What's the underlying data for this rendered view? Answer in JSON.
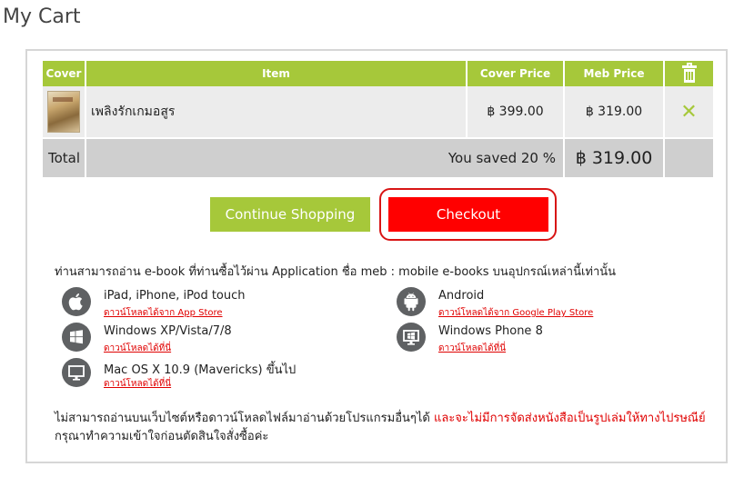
{
  "page": {
    "title": "My Cart"
  },
  "cart": {
    "headers": {
      "cover": "Cover",
      "item": "Item",
      "cover_price": "Cover Price",
      "meb_price": "Meb Price"
    },
    "items": [
      {
        "title": "เพลิงรักเกมอสูร",
        "cover_price": "฿ 399.00",
        "meb_price": "฿ 319.00",
        "remove_symbol": "✕"
      }
    ],
    "total": {
      "label": "Total",
      "saved_text": "You saved 20 %",
      "amount": "฿ 319.00"
    }
  },
  "buttons": {
    "continue_label": "Continue Shopping",
    "checkout_label": "Checkout"
  },
  "info": {
    "intro": "ท่านสามารถอ่าน e-book ที่ท่านซื้อไว้ผ่าน Application ชื่อ meb : mobile e-books บนอุปกรณ์เหล่านี้เท่านั้น",
    "platforms": [
      {
        "name": "iPad, iPhone, iPod touch",
        "link": "ดาวน์โหลดได้จาก App Store",
        "icon": "apple-icon"
      },
      {
        "name": "Android",
        "link": "ดาวน์โหลดได้จาก Google Play Store",
        "icon": "android-icon"
      },
      {
        "name": "Windows XP/Vista/7/8",
        "link": "ดาวน์โหลดได้ที่นี่",
        "icon": "windows-icon"
      },
      {
        "name": "Windows Phone 8",
        "link": "ดาวน์โหลดได้ที่นี่",
        "icon": "monitor-icon"
      },
      {
        "name": "Mac OS X 10.9 (Mavericks) ขึ้นไป",
        "link": "ดาวน์โหลดได้ที่นี่",
        "icon": "monitor-icon"
      }
    ],
    "note_black": "ไม่สามารถอ่านบนเว็บไซต์หรือดาวน์โหลดไฟล์มาอ่านด้วยโปรแกรมอื่นๆได้ ",
    "note_red": "และจะไม่มีการจัดส่งหนังสือเป็นรูปเล่มให้ทางไปรษณีย์",
    "note_tail": "กรุณาทำความเข้าใจก่อนตัดสินใจสั่งซื้อค่ะ"
  },
  "colors": {
    "accent_green": "#a6c83a",
    "checkout_red": "#ff0000",
    "icon_grey": "#5f6163"
  }
}
